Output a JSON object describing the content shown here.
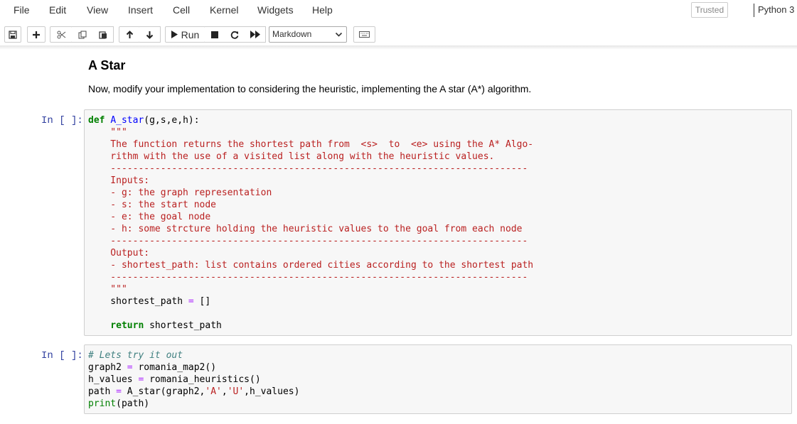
{
  "menubar": {
    "items": [
      "File",
      "Edit",
      "View",
      "Insert",
      "Cell",
      "Kernel",
      "Widgets",
      "Help"
    ],
    "trusted": "Trusted",
    "kernel": "Python 3"
  },
  "toolbar": {
    "run_label": "Run",
    "cell_type": "Markdown",
    "icons": [
      "save-icon",
      "plus-icon",
      "scissors-icon",
      "copy-icon",
      "paste-icon",
      "arrow-up-icon",
      "arrow-down-icon",
      "play-icon",
      "stop-icon",
      "restart-icon",
      "fast-forward-icon",
      "keyboard-icon"
    ]
  },
  "markdown": {
    "title": "A Star",
    "paragraph": "Now, modify your implementation to considering the heuristic, implementing the A star (A*) algorithm."
  },
  "cells": [
    {
      "prompt": "In [ ]:",
      "lines": {
        "l1_def": "def",
        "l1_name": "A_star",
        "l1_rest": "(g,s,e,h):",
        "l2": "    \"\"\"",
        "l3": "    The function returns the shortest path from  <s>  to  <e> using the A* Algo-",
        "l4": "    rithm with the use of a visited list along with the heuristic values.",
        "l5": "    ---------------------------------------------------------------------------",
        "l6": "    Inputs:",
        "l7": "    - g: the graph representation",
        "l8": "    - s: the start node",
        "l9": "    - e: the goal node",
        "l10": "    - h: some strcture holding the heuristic values to the goal from each node",
        "l11": "    ---------------------------------------------------------------------------",
        "l12": "    Output:",
        "l13": "    - shortest_path: list contains ordered cities according to the shortest path",
        "l14": "    ---------------------------------------------------------------------------",
        "l15": "    \"\"\"",
        "l16_a": "    shortest_path ",
        "l16_op": "=",
        "l16_b": " []",
        "l18_kw": "    return",
        "l18_b": " shortest_path"
      }
    },
    {
      "prompt": "In [ ]:",
      "lines": {
        "l1": "# Lets try it out",
        "l2_a": "graph2 ",
        "l2_op": "=",
        "l2_b": " romania_map2()",
        "l3_a": "h_values ",
        "l3_op": "=",
        "l3_b": " romania_heuristics()",
        "l4_a": "path ",
        "l4_op": "=",
        "l4_b": " A_star(graph2,",
        "l4_s1": "'A'",
        "l4_c": ",",
        "l4_s2": "'U'",
        "l4_d": ",h_values)",
        "l5_fn": "print",
        "l5_b": "(path)"
      }
    }
  ]
}
